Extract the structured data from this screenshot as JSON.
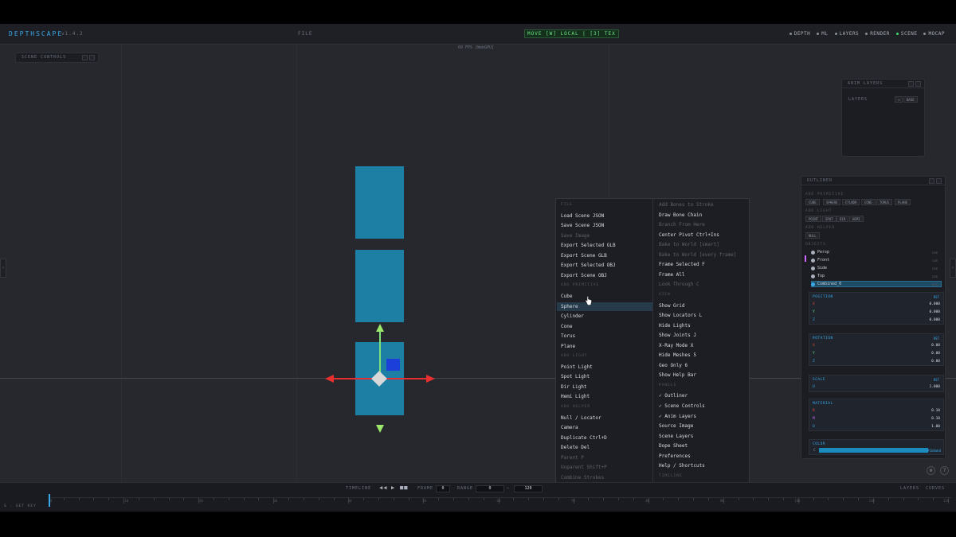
{
  "app": {
    "name": "DEPTHSCAPE",
    "version": "v1.4.2",
    "file_menu": "FILE",
    "mode_badge": "MOVE [W] LOCAL | [3] TEX",
    "fps": "60 FPS [WebGPU]"
  },
  "toggles": [
    {
      "label": "DEPTH",
      "on": false
    },
    {
      "label": "ML",
      "on": false
    },
    {
      "label": "LAYERS",
      "on": false
    },
    {
      "label": "RENDER",
      "on": false
    },
    {
      "label": "SCENE",
      "on": true
    },
    {
      "label": "MOCAP",
      "on": false
    }
  ],
  "scene_controls": {
    "title": "SCENE CONTROLS"
  },
  "anim_layers": {
    "title": "ANIM LAYERS",
    "label": "LAYERS",
    "add": "+",
    "base": "BASE"
  },
  "context_menu": {
    "left": [
      {
        "label": "FILE",
        "type": "section"
      },
      {
        "label": "Load Scene JSON",
        "type": "item"
      },
      {
        "label": "Save Scene JSON",
        "type": "item"
      },
      {
        "label": "Save Image",
        "type": "disabled"
      },
      {
        "label": "Export Selected GLB",
        "type": "item"
      },
      {
        "label": "Export Scene GLB",
        "type": "item"
      },
      {
        "label": "Export Selected OBJ",
        "type": "item"
      },
      {
        "label": "Export Scene OBJ",
        "type": "item"
      },
      {
        "label": "ADD PRIMITIVE",
        "type": "section"
      },
      {
        "label": "Cube",
        "type": "item"
      },
      {
        "label": "Sphere",
        "type": "item",
        "highlighted": true
      },
      {
        "label": "Cylinder",
        "type": "item"
      },
      {
        "label": "Cone",
        "type": "item"
      },
      {
        "label": "Torus",
        "type": "item"
      },
      {
        "label": "Plane",
        "type": "item"
      },
      {
        "label": "ADD LIGHT",
        "type": "section"
      },
      {
        "label": "Point Light",
        "type": "item"
      },
      {
        "label": "Spot Light",
        "type": "item"
      },
      {
        "label": "Dir Light",
        "type": "item"
      },
      {
        "label": "Hemi Light",
        "type": "item"
      },
      {
        "label": "ADD HELPER",
        "type": "section"
      },
      {
        "label": "Null / Locator",
        "type": "item"
      },
      {
        "label": "Camera",
        "type": "item"
      },
      {
        "label": "Duplicate Ctrl+D",
        "type": "item"
      },
      {
        "label": "Delete Del",
        "type": "item"
      },
      {
        "label": "Parent P",
        "type": "disabled"
      },
      {
        "label": "Unparent Shift+P",
        "type": "disabled"
      },
      {
        "label": "Combine Strokes",
        "type": "disabled"
      },
      {
        "label": "Combine All",
        "type": "disabled"
      },
      {
        "label": "Separate",
        "type": "item"
      }
    ],
    "right": [
      {
        "label": "Add Bones to Stroke",
        "type": "disabled"
      },
      {
        "label": "Draw Bone Chain",
        "type": "item"
      },
      {
        "label": "Branch From Here",
        "type": "disabled"
      },
      {
        "label": "Center Pivot Ctrl+Ins",
        "type": "item"
      },
      {
        "label": "Bake to World [smart]",
        "type": "disabled"
      },
      {
        "label": "Bake to World [every frame]",
        "type": "disabled"
      },
      {
        "label": "Frame Selected F",
        "type": "item"
      },
      {
        "label": "Frame All",
        "type": "item"
      },
      {
        "label": "Look Through C",
        "type": "disabled"
      },
      {
        "label": "VIEW",
        "type": "section"
      },
      {
        "label": "Show Grid",
        "type": "item"
      },
      {
        "label": "Show Locators L",
        "type": "item"
      },
      {
        "label": "Hide Lights",
        "type": "item"
      },
      {
        "label": "Show Joints J",
        "type": "item"
      },
      {
        "label": "X-Ray Mode X",
        "type": "item"
      },
      {
        "label": "Hide Meshes 5",
        "type": "item"
      },
      {
        "label": "Geo Only 6",
        "type": "item"
      },
      {
        "label": "Show Help Bar",
        "type": "item"
      },
      {
        "label": "PANELS",
        "type": "section"
      },
      {
        "label": "✓ Outliner",
        "type": "item"
      },
      {
        "label": "✓ Scene Controls",
        "type": "item"
      },
      {
        "label": "✓ Anim Layers",
        "type": "item"
      },
      {
        "label": "Source Image",
        "type": "item"
      },
      {
        "label": "Scene Layers",
        "type": "item"
      },
      {
        "label": "Dope Sheet",
        "type": "item"
      },
      {
        "label": "Preferences",
        "type": "item"
      },
      {
        "label": "Help / Shortcuts",
        "type": "item"
      },
      {
        "label": "TIMELINE",
        "type": "section"
      },
      {
        "label": "Set Key (selected) S",
        "type": "item"
      },
      {
        "label": "Set Key (all objects) Shift+S",
        "type": "item"
      }
    ]
  },
  "outliner": {
    "title": "OUTLINER",
    "add_primitive": "ADD PRIMITIVE",
    "primitives": [
      "CUBE",
      "SPHERE",
      "CYLNDR",
      "CONE",
      "TORUS",
      "PLANE"
    ],
    "add_light": "ADD LIGHT",
    "lights": [
      "POINT",
      "SPOT",
      "DIR",
      "HEMI"
    ],
    "add_helper": "ADD HELPER",
    "helpers": [
      "NULL"
    ],
    "objects_label": "OBJECTS",
    "objects": [
      {
        "name": "Persp",
        "tag": "cam",
        "color": "#aab0bb"
      },
      {
        "name": "Front",
        "tag": "cam",
        "color": "#aab0bb"
      },
      {
        "name": "Side",
        "tag": "cam",
        "color": "#aab0bb"
      },
      {
        "name": "Top",
        "tag": "cam",
        "color": "#aab0bb"
      },
      {
        "name": "Combined_0",
        "tag": "grp",
        "color": "#38a8e8",
        "selected": true
      }
    ],
    "position": {
      "title": "POSITION",
      "reset": "RST",
      "rows": [
        {
          "axis": "X",
          "value": "0.000",
          "color": "#e8473b"
        },
        {
          "axis": "Y",
          "value": "0.000",
          "color": "#6ee787"
        },
        {
          "axis": "Z",
          "value": "0.000",
          "color": "#38a8e8"
        }
      ]
    },
    "rotation": {
      "title": "ROTATION",
      "reset": "RST",
      "rows": [
        {
          "axis": "X",
          "value": "0.00",
          "color": "#e8473b"
        },
        {
          "axis": "Y",
          "value": "0.00",
          "color": "#6ee787"
        },
        {
          "axis": "Z",
          "value": "0.00",
          "color": "#38a8e8"
        }
      ]
    },
    "scale": {
      "title": "SCALE",
      "reset": "RST",
      "rows": [
        {
          "axis": "U",
          "value": "1.000",
          "color": "#38a8e8"
        }
      ]
    },
    "material": {
      "title": "MATERIAL",
      "rows": [
        {
          "axis": "R",
          "value": "0.10",
          "color": "#e8473b"
        },
        {
          "axis": "M",
          "value": "0.10",
          "color": "#cc66ff"
        },
        {
          "axis": "O",
          "value": "1.00",
          "color": "#38a8e8"
        }
      ]
    },
    "color": {
      "title": "COLOR",
      "hex": "#1b8abd",
      "label": "C"
    }
  },
  "timeline": {
    "label": "TIMELINE",
    "frame_label": "FRAME",
    "frame": "0",
    "range_label": "RANGE",
    "range_start": "0",
    "range_end": "120",
    "layers": "LAYERS",
    "curves": "CURVES",
    "key_hint": "S · SET KEY",
    "ticks": [
      "0",
      "10",
      "20",
      "30",
      "40",
      "50",
      "60",
      "70",
      "80",
      "90",
      "100",
      "110",
      "120"
    ]
  }
}
